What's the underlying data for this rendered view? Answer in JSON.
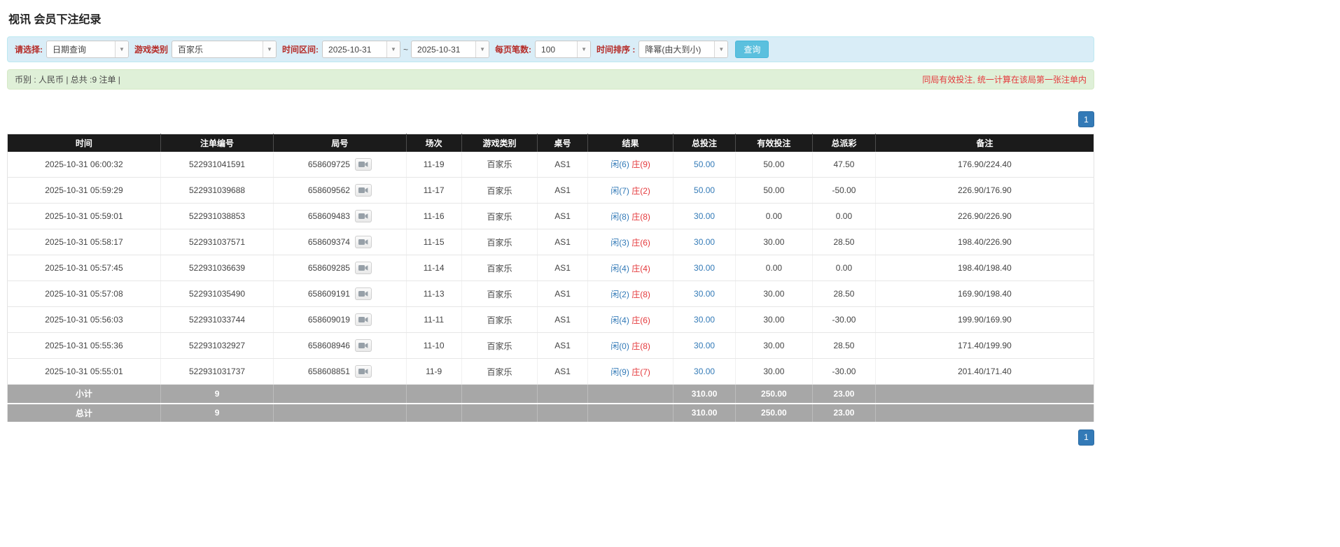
{
  "title": "视讯 会员下注纪录",
  "filter": {
    "select_label": "请选择:",
    "select_value": "日期查询",
    "game_type_label": "游戏类别",
    "game_type_value": "百家乐",
    "date_range_label": "时间区间:",
    "date_from": "2025-10-31",
    "tilde": "~",
    "date_to": "2025-10-31",
    "per_page_label": "每页笔数:",
    "per_page_value": "100",
    "sort_label": "时间排序 :",
    "sort_value": "降幂(由大到小)",
    "query_label": "查询"
  },
  "info": {
    "summary": "币别 : 人民币 | 总共 :9 注单 |",
    "note": "同局有效投注, 统一计算在该局第一张注单内"
  },
  "pagination": {
    "page": "1"
  },
  "colors": {
    "accent_blue": "#337ab7",
    "negative_red": "#e4393c",
    "player_blue": "#337ab7",
    "banker_red": "#e4393c",
    "header_bg": "#1b1b1b",
    "footer_bg": "#a7a7a7",
    "filter_bg": "#d9edf7",
    "info_bg": "#dff0d8",
    "query_button_bg": "#5bc0de"
  },
  "table": {
    "headers": [
      "时间",
      "注单编号",
      "局号",
      "场次",
      "游戏类别",
      "桌号",
      "结果",
      "总投注",
      "有效投注",
      "总派彩",
      "备注"
    ],
    "rows": [
      {
        "time": "2025-10-31 06:00:32",
        "bet_id": "522931041591",
        "round_id": "658609725",
        "session": "11-19",
        "game": "百家乐",
        "table_no": "AS1",
        "result_player": "闲(6)",
        "result_banker": "庄(9)",
        "total_bet": "50.00",
        "valid_bet": "50.00",
        "payout": "47.50",
        "payout_negative": false,
        "remark": "176.90/224.40"
      },
      {
        "time": "2025-10-31 05:59:29",
        "bet_id": "522931039688",
        "round_id": "658609562",
        "session": "11-17",
        "game": "百家乐",
        "table_no": "AS1",
        "result_player": "闲(7)",
        "result_banker": "庄(2)",
        "total_bet": "50.00",
        "valid_bet": "50.00",
        "payout": "-50.00",
        "payout_negative": true,
        "remark": "226.90/176.90"
      },
      {
        "time": "2025-10-31 05:59:01",
        "bet_id": "522931038853",
        "round_id": "658609483",
        "session": "11-16",
        "game": "百家乐",
        "table_no": "AS1",
        "result_player": "闲(8)",
        "result_banker": "庄(8)",
        "total_bet": "30.00",
        "valid_bet": "0.00",
        "payout": "0.00",
        "payout_negative": false,
        "remark": "226.90/226.90"
      },
      {
        "time": "2025-10-31 05:58:17",
        "bet_id": "522931037571",
        "round_id": "658609374",
        "session": "11-15",
        "game": "百家乐",
        "table_no": "AS1",
        "result_player": "闲(3)",
        "result_banker": "庄(6)",
        "total_bet": "30.00",
        "valid_bet": "30.00",
        "payout": "28.50",
        "payout_negative": false,
        "remark": "198.40/226.90"
      },
      {
        "time": "2025-10-31 05:57:45",
        "bet_id": "522931036639",
        "round_id": "658609285",
        "session": "11-14",
        "game": "百家乐",
        "table_no": "AS1",
        "result_player": "闲(4)",
        "result_banker": "庄(4)",
        "total_bet": "30.00",
        "valid_bet": "0.00",
        "payout": "0.00",
        "payout_negative": false,
        "remark": "198.40/198.40"
      },
      {
        "time": "2025-10-31 05:57:08",
        "bet_id": "522931035490",
        "round_id": "658609191",
        "session": "11-13",
        "game": "百家乐",
        "table_no": "AS1",
        "result_player": "闲(2)",
        "result_banker": "庄(8)",
        "total_bet": "30.00",
        "valid_bet": "30.00",
        "payout": "28.50",
        "payout_negative": false,
        "remark": "169.90/198.40"
      },
      {
        "time": "2025-10-31 05:56:03",
        "bet_id": "522931033744",
        "round_id": "658609019",
        "session": "11-11",
        "game": "百家乐",
        "table_no": "AS1",
        "result_player": "闲(4)",
        "result_banker": "庄(6)",
        "total_bet": "30.00",
        "valid_bet": "30.00",
        "payout": "-30.00",
        "payout_negative": true,
        "remark": "199.90/169.90"
      },
      {
        "time": "2025-10-31 05:55:36",
        "bet_id": "522931032927",
        "round_id": "658608946",
        "session": "11-10",
        "game": "百家乐",
        "table_no": "AS1",
        "result_player": "闲(0)",
        "result_banker": "庄(8)",
        "total_bet": "30.00",
        "valid_bet": "30.00",
        "payout": "28.50",
        "payout_negative": false,
        "remark": "171.40/199.90"
      },
      {
        "time": "2025-10-31 05:55:01",
        "bet_id": "522931031737",
        "round_id": "658608851",
        "session": "11-9",
        "game": "百家乐",
        "table_no": "AS1",
        "result_player": "闲(9)",
        "result_banker": "庄(7)",
        "total_bet": "30.00",
        "valid_bet": "30.00",
        "payout": "-30.00",
        "payout_negative": false,
        "remark": "201.40/171.40"
      }
    ],
    "footer": [
      {
        "label": "小计",
        "count": "9",
        "total_bet": "310.00",
        "valid_bet": "250.00",
        "payout": "23.00"
      },
      {
        "label": "总计",
        "count": "9",
        "total_bet": "310.00",
        "valid_bet": "250.00",
        "payout": "23.00"
      }
    ]
  }
}
